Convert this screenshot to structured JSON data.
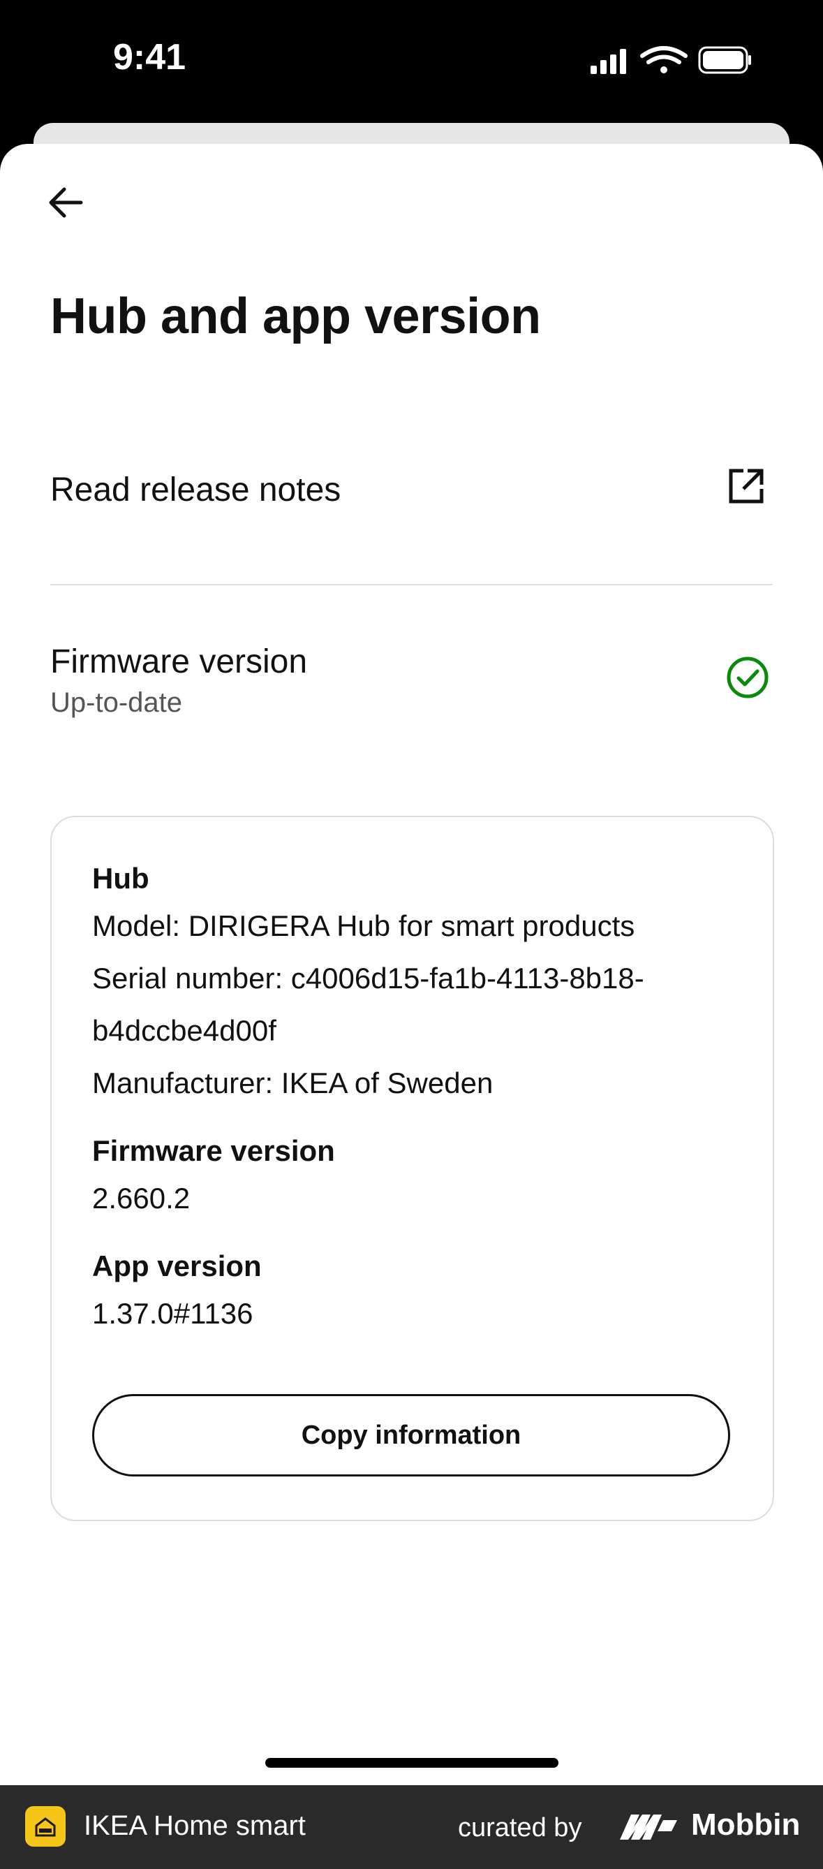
{
  "status_bar": {
    "time": "9:41"
  },
  "header": {
    "title": "Hub and app version"
  },
  "release_notes": {
    "label": "Read release notes"
  },
  "firmware_row": {
    "label": "Firmware version",
    "status": "Up-to-date"
  },
  "info_card": {
    "hub_title": "Hub",
    "model": "Model: DIRIGERA Hub for smart products",
    "serial_line1": "Serial number: c4006d15-fa1b-4113-8b18-",
    "serial_line2": "b4dccbe4d00f",
    "manufacturer": "Manufacturer: IKEA of Sweden",
    "firmware_title": "Firmware version",
    "firmware_value": "2.660.2",
    "app_title": "App version",
    "app_value": "1.37.0#1136",
    "copy_button": "Copy information"
  },
  "footer": {
    "app_name": "IKEA Home smart",
    "curated_by": "curated by",
    "brand": "Mobbin"
  },
  "colors": {
    "check_green": "#0a8a0a",
    "footer_bg": "#2a2a2a",
    "app_icon": "#f5c518"
  }
}
